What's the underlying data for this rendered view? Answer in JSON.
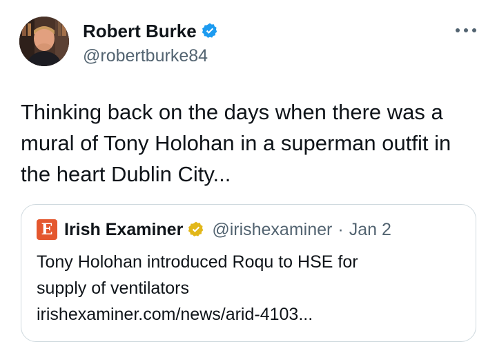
{
  "author": {
    "display_name": "Robert Burke",
    "handle": "@robertburke84",
    "verified": true,
    "avatar_icon": "profile-photo"
  },
  "more_icon": "more-horizontal-icon",
  "tweet": {
    "text": "Thinking back on the days when there was a\nmural of Tony Holohan in a superman outfit in\nthe heart Dublin City..."
  },
  "quote": {
    "logo_glyph": "E",
    "display_name": "Irish Examiner",
    "verified_type": "gold-business",
    "handle": "@irishexaminer",
    "separator": "·",
    "date": "Jan 2",
    "lines": [
      "Tony Holohan introduced Roqu to HSE for",
      "supply of ventilators",
      "irishexaminer.com/news/arid-4103..."
    ]
  },
  "colors": {
    "verified_blue": "#1d9bf0",
    "verified_gold": "#e2b719",
    "secondary_text": "#536471",
    "logo_orange": "#e4572e"
  }
}
